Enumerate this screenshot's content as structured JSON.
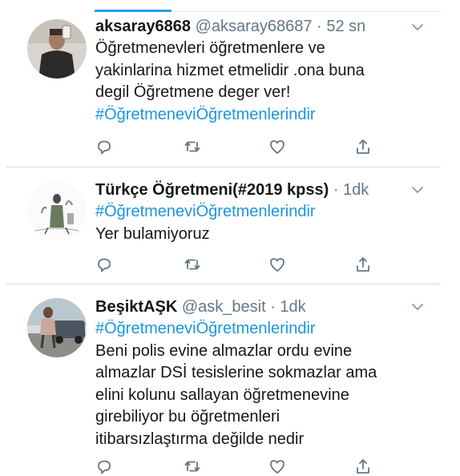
{
  "tweets": [
    {
      "name": "aksaray6868",
      "handle": "@aksaray68687",
      "time": "52 sn",
      "lines": [
        "Öğretmenevleri öğretmenlere ve",
        "yakinlarina hizmet etmelidir .ona buna",
        "degil Öğretmene deger ver!"
      ],
      "hashtag": "#ÖğretmeneviÖğretmenlerindir",
      "hashtag_first": false
    },
    {
      "name": "Türkçe Öğretmeni(#2019 kpss)",
      "handle": "",
      "time": "1dk",
      "lines": [
        "Yer bulamiyoruz"
      ],
      "hashtag": "#ÖğretmeneviÖğretmenlerindir",
      "hashtag_first": true
    },
    {
      "name": "BeşiktAŞK",
      "handle": "@ask_besit",
      "time": "1dk",
      "lines": [
        "Beni polis evine almazlar ordu evine",
        "almazlar DSİ tesislerine sokmazlar ama",
        "elini kolunu sallayan öğretmenevine",
        "girebiliyor bu öğretmenleri",
        "itibarsızlaştırma değilde nedir"
      ],
      "hashtag": "#ÖğretmeneviÖğretmenlerindir",
      "hashtag_first": true
    }
  ],
  "icons": [
    "reply-icon",
    "retweet-icon",
    "like-icon",
    "share-icon",
    "chevron-down-icon"
  ],
  "colors": {
    "link": "#1b95e0",
    "muted": "#657786",
    "icon": "#657786",
    "divider": "#d6dde2"
  }
}
